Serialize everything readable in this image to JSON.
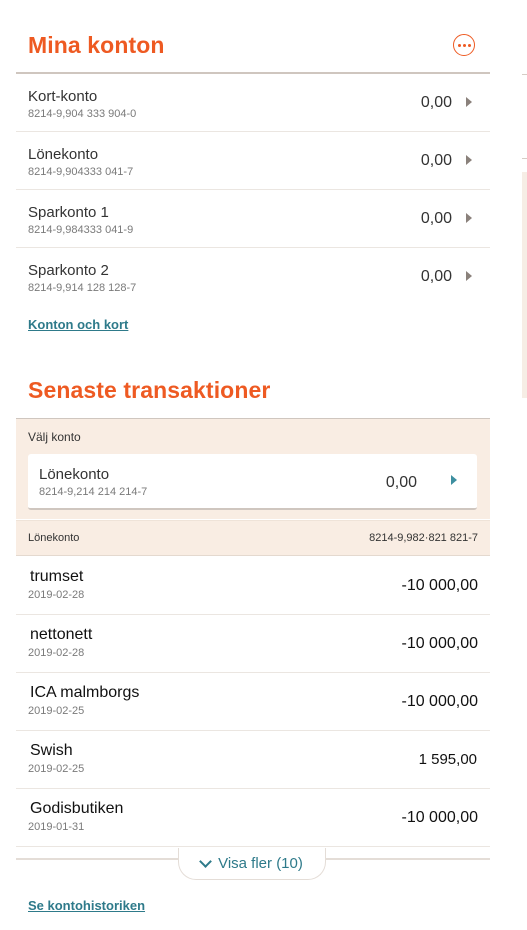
{
  "accounts_section": {
    "title": "Mina konton",
    "more_icon": "more-horizontal-icon",
    "accounts": [
      {
        "name": "Kort-konto",
        "number": "8214-9,904 333 904-0",
        "balance": "0,00"
      },
      {
        "name": "Lönekonto",
        "number": "8214-9,904333 041-7",
        "balance": "0,00"
      },
      {
        "name": "Sparkonto 1",
        "number": "8214-9,984333 041-9",
        "balance": "0,00"
      },
      {
        "name": "Sparkonto 2",
        "number": "8214-9,914 128 128-7",
        "balance": "0,00"
      }
    ],
    "link": "Konton och kort"
  },
  "transactions_section": {
    "title": "Senaste transaktioner",
    "select_label": "Välj konto",
    "selected_account": {
      "name": "Lönekonto",
      "number": "8214-9,214 214 214-7",
      "balance": "0,00"
    },
    "account_strip": {
      "name": "Lönekonto",
      "number": "8214-9,982·821 821-7"
    },
    "transactions": [
      {
        "name": "trumset",
        "date": "2019-02-28",
        "amount": "-10 000,00"
      },
      {
        "name": "nettonett",
        "date": "2019-02-28",
        "amount": "-10 000,00"
      },
      {
        "name": "ICA malmborgs",
        "date": "2019-02-25",
        "amount": "-10 000,00"
      },
      {
        "name": "Swish",
        "date": "2019-02-25",
        "amount": "1 595,00"
      },
      {
        "name": "Godisbutiken",
        "date": "2019-01-31",
        "amount": "-10 000,00"
      }
    ],
    "show_more": "Visa fler (10)",
    "history_link": "Se kontohistoriken"
  },
  "colors": {
    "accent": "#ee5a22",
    "link": "#2e7a8a",
    "panel_bg": "#f9ede3"
  }
}
